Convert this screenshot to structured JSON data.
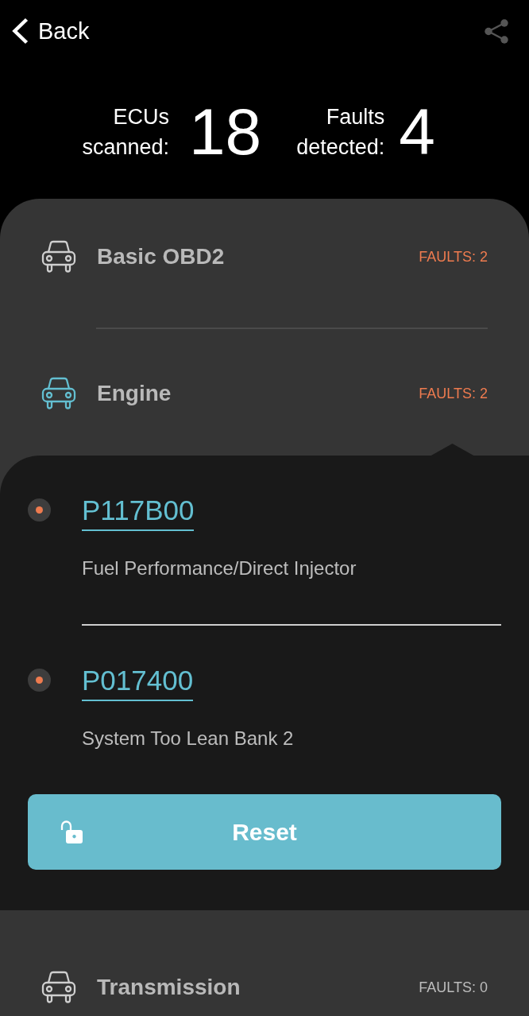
{
  "header": {
    "back_label": "Back"
  },
  "summary": [
    {
      "label": "ECUs scanned:",
      "value": "18"
    },
    {
      "label": "Faults detected:",
      "value": "4"
    }
  ],
  "modules": [
    {
      "name": "Basic OBD2",
      "faults_label": "FAULTS: 2",
      "alert": true,
      "expanded": false
    },
    {
      "name": "Engine",
      "faults_label": "FAULTS: 2",
      "alert": true,
      "expanded": true,
      "faults": [
        {
          "code": "P117B00",
          "description": "Fuel Performance/Direct Injector"
        },
        {
          "code": "P017400",
          "description": "System Too Lean Bank 2"
        }
      ],
      "action_label": "Reset"
    },
    {
      "name": "Transmission",
      "faults_label": "FAULTS: 0",
      "alert": false,
      "expanded": false
    }
  ]
}
